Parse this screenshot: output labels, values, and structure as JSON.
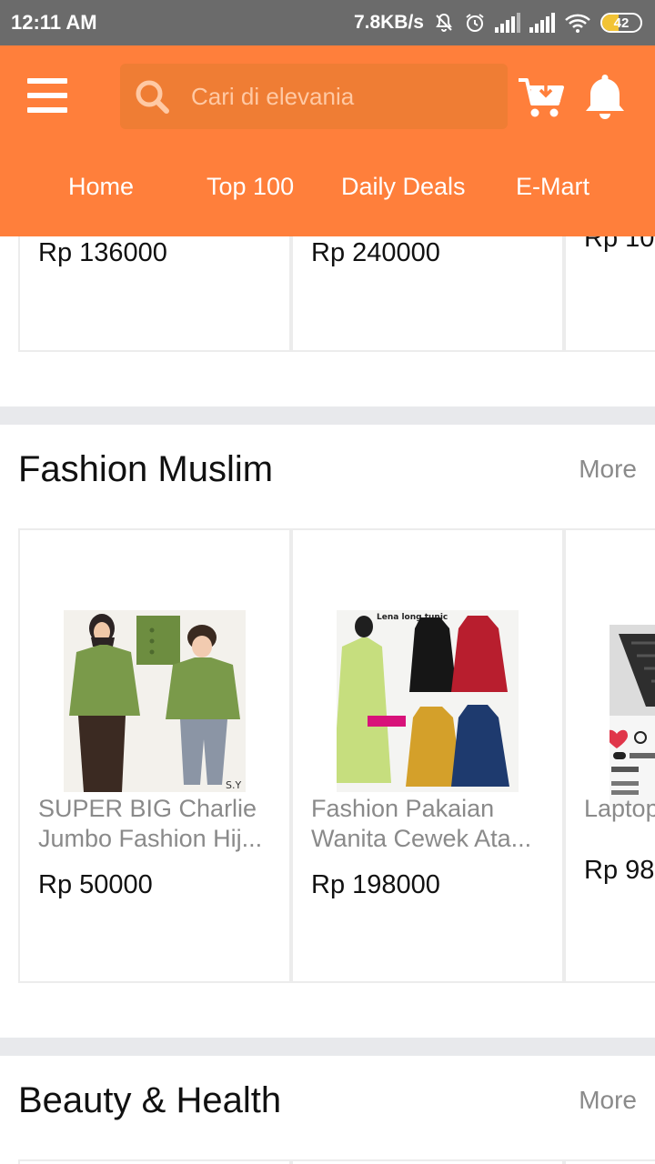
{
  "status_bar": {
    "time": "12:11 AM",
    "network_speed": "7.8KB/s",
    "battery": "42",
    "battery_level": 0.42
  },
  "header": {
    "search_placeholder": "Cari di elevania",
    "tabs": [
      {
        "label": "Home"
      },
      {
        "label": "Top 100"
      },
      {
        "label": "Daily Deals"
      },
      {
        "label": "E-Mart"
      }
    ],
    "color": "#ff7f3b"
  },
  "top_row": {
    "prices": [
      "Rp 136000",
      "Rp 240000",
      "Rp 10"
    ]
  },
  "sections": [
    {
      "title": "Fashion Muslim",
      "more": "More",
      "products": [
        {
          "title_line1": "SUPER BIG Charlie",
          "title_line2": "Jumbo Fashion Hij...",
          "price": "Rp 50000",
          "image": "green-blouse-photo"
        },
        {
          "title_line1": "Fashion Pakaian",
          "title_line2": "Wanita Cewek Ata...",
          "price": "Rp 198000",
          "image": "tunic-colors-photo",
          "image_text": "Lena long tunic"
        },
        {
          "title_line1": "Laptop",
          "price": "Rp 98",
          "image": "laptop-photo"
        }
      ]
    },
    {
      "title": "Beauty & Health",
      "more": "More"
    }
  ]
}
